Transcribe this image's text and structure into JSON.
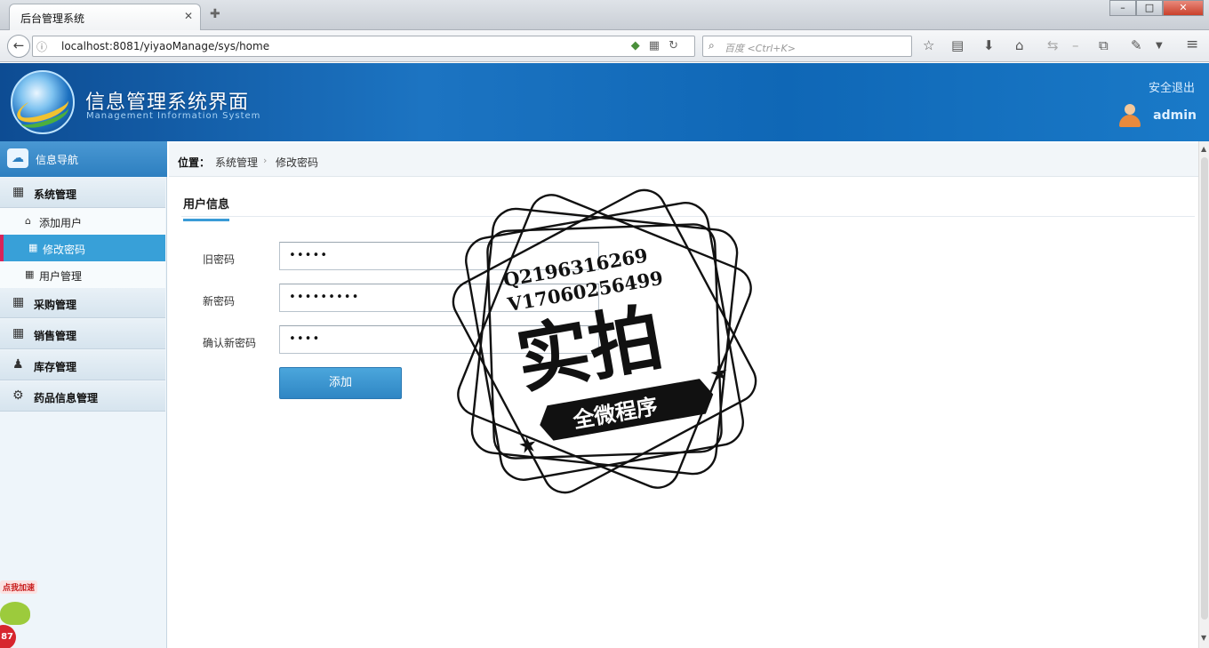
{
  "browser": {
    "tab_title": "后台管理系统",
    "tab_close": "✕",
    "new_tab": "✚",
    "url": "localhost:8081/yiyaoManage/sys/home",
    "search_placeholder": "百度 <Ctrl+K>"
  },
  "header": {
    "title": "信息管理系统界面",
    "subtitle": "Management Information System",
    "logout": "安全退出",
    "username": "admin"
  },
  "sidebar": {
    "top_label": "信息导航",
    "groups": [
      {
        "label": "系统管理",
        "items": [
          "添加用户",
          "修改密码",
          "用户管理"
        ]
      },
      {
        "label": "采购管理"
      },
      {
        "label": "销售管理"
      },
      {
        "label": "库存管理"
      },
      {
        "label": "药品信息管理"
      }
    ],
    "active_item": "修改密码",
    "promo_tag": "点我加速",
    "promo_badge": "87"
  },
  "breadcrumb": {
    "label": "位置：",
    "items": [
      "系统管理",
      "修改密码"
    ]
  },
  "form": {
    "section_tab": "用户信息",
    "fields": [
      {
        "label": "旧密码",
        "value": "•••••"
      },
      {
        "label": "新密码",
        "value": "•••••••••"
      },
      {
        "label": "确认新密码",
        "value": "••••"
      }
    ],
    "submit_label": "添加"
  },
  "watermark": {
    "line1": "Q2196316269",
    "line2": "V17060256499",
    "main": "实拍",
    "banner": "全微程序"
  },
  "colors": {
    "header_blue": "#1c74c2",
    "active_item": "#38a0d8",
    "active_marker": "#d8245a",
    "button": "#3a94cf"
  }
}
